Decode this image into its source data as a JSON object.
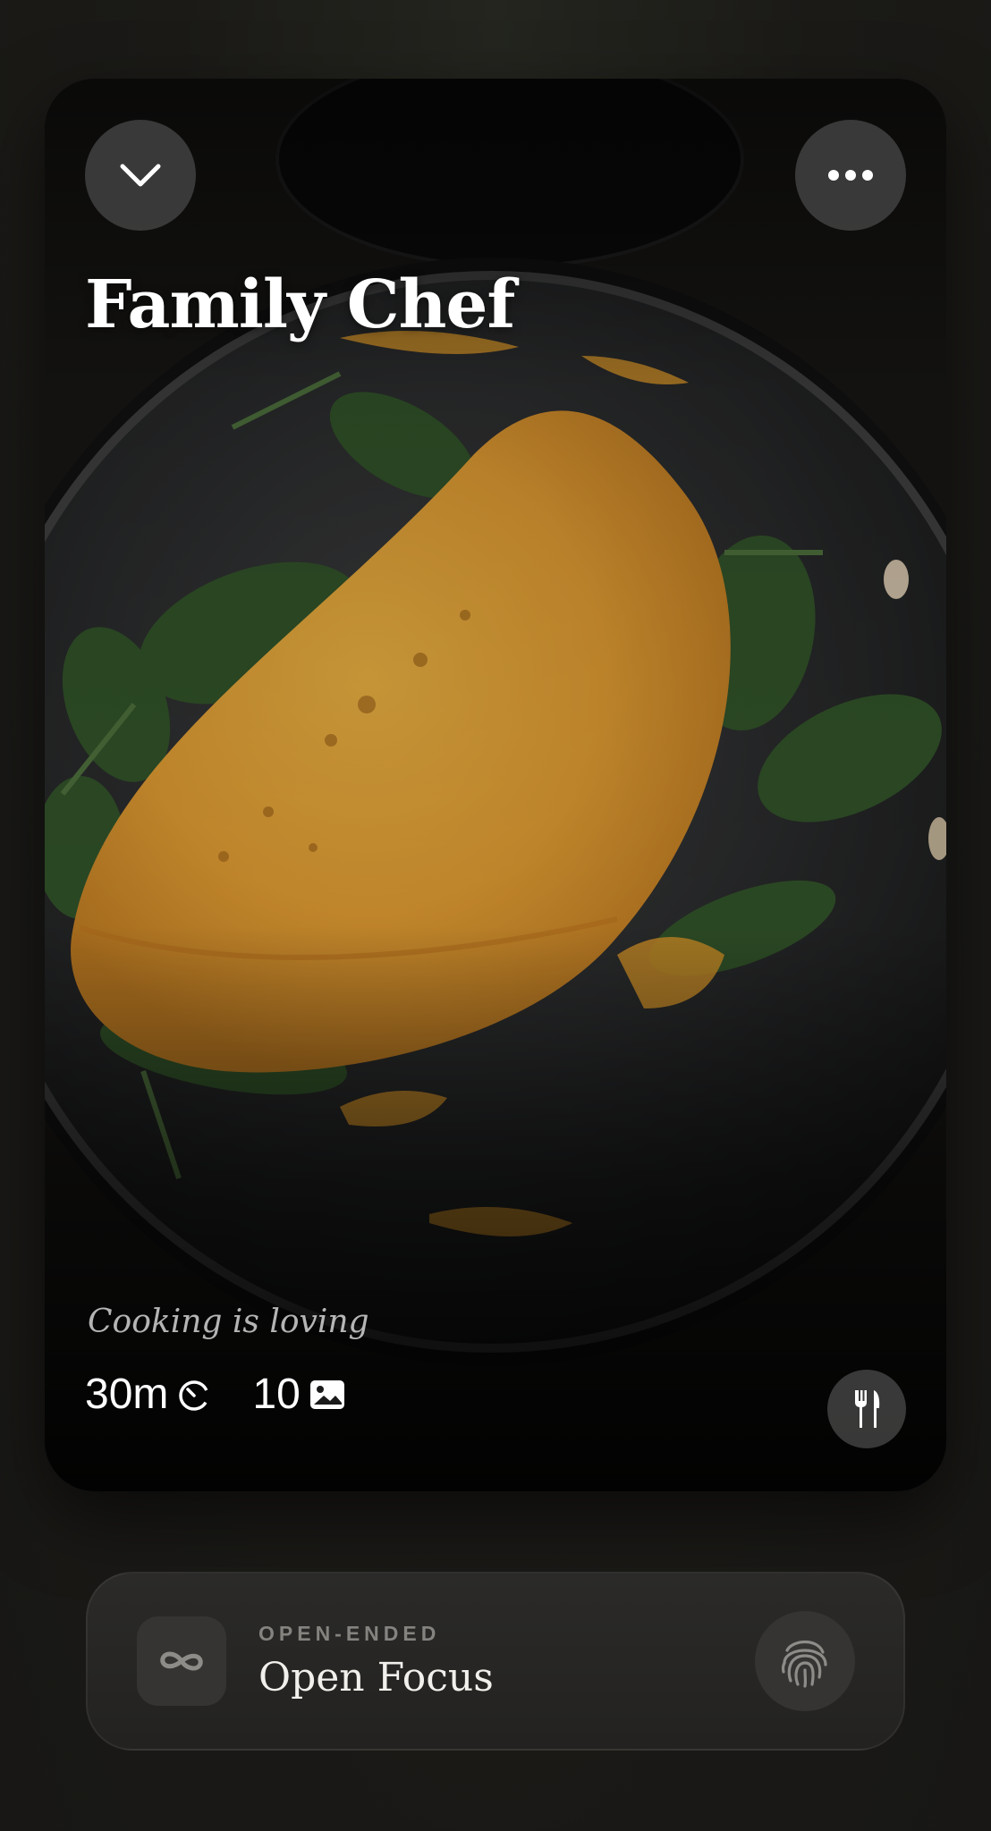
{
  "recipe": {
    "title": "Family Chef",
    "tagline": "Cooking is loving",
    "stats": {
      "time": "30m",
      "time_icon": "timer-icon",
      "photos": "10",
      "photos_icon": "image-icon"
    },
    "image": "folded omelette with spinach in a frying pan"
  },
  "controls": {
    "collapse_icon": "chevron-down-icon",
    "more_icon": "more-horizontal-icon",
    "utensils_icon": "fork-knife-icon"
  },
  "focus": {
    "kicker": "OPEN-ENDED",
    "title": "Open Focus",
    "mode_icon": "infinity-icon",
    "action_icon": "fingerprint-icon"
  },
  "colors": {
    "background": "#1b1a17",
    "omelette": "#e2a032",
    "spinach": "#2f4f27",
    "pan": "#1f1f1f"
  }
}
